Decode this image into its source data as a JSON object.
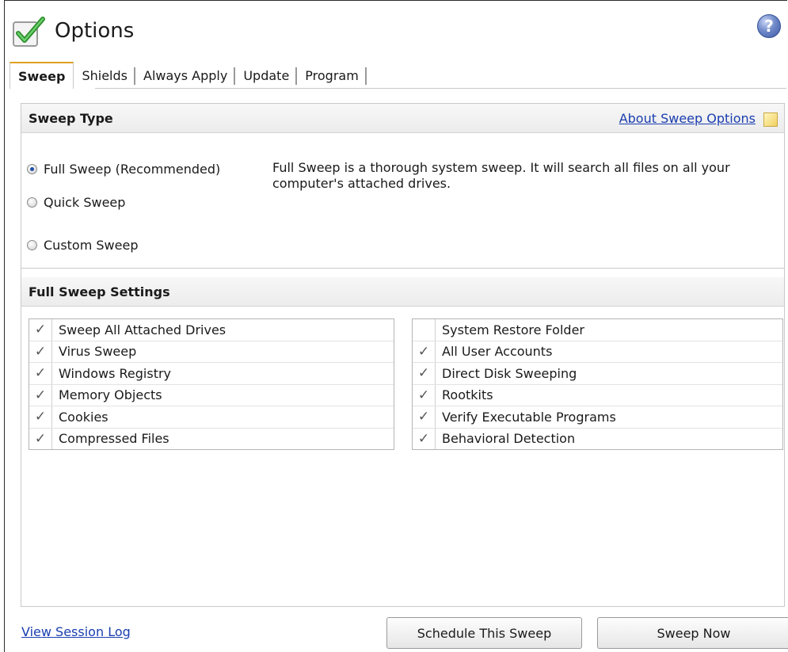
{
  "header": {
    "title": "Options",
    "help_glyph": "?"
  },
  "tabs": [
    {
      "label": "Sweep",
      "active": true
    },
    {
      "label": "Shields",
      "active": false
    },
    {
      "label": "Always Apply",
      "active": false
    },
    {
      "label": "Update",
      "active": false
    },
    {
      "label": "Program",
      "active": false
    }
  ],
  "sweep_type": {
    "heading": "Sweep Type",
    "about_link": "About Sweep Options",
    "options": [
      {
        "label": "Full Sweep (Recommended)",
        "selected": true
      },
      {
        "label": "Quick Sweep",
        "selected": false
      },
      {
        "label": "Custom Sweep",
        "selected": false
      }
    ],
    "description": "Full Sweep is a thorough system sweep. It will search all files on all your computer's attached drives."
  },
  "settings": {
    "heading": "Full Sweep Settings",
    "left": [
      {
        "label": "Sweep All Attached Drives",
        "checked": true
      },
      {
        "label": "Virus Sweep",
        "checked": true
      },
      {
        "label": "Windows Registry",
        "checked": true
      },
      {
        "label": "Memory Objects",
        "checked": true
      },
      {
        "label": "Cookies",
        "checked": true
      },
      {
        "label": "Compressed Files",
        "checked": true
      }
    ],
    "right": [
      {
        "label": "System Restore Folder",
        "checked": false
      },
      {
        "label": "All User Accounts",
        "checked": true
      },
      {
        "label": "Direct Disk Sweeping",
        "checked": true
      },
      {
        "label": "Rootkits",
        "checked": true
      },
      {
        "label": "Verify Executable Programs",
        "checked": true
      },
      {
        "label": "Behavioral Detection",
        "checked": true
      }
    ]
  },
  "footer": {
    "session_link": "View Session Log",
    "schedule_button": "Schedule This Sweep",
    "sweep_button": "Sweep Now"
  },
  "check_glyph": "✓",
  "colors": {
    "link": "#1a3eb0",
    "tab_accent": "#e0a020",
    "radio_selected": "#1f4fa8"
  }
}
